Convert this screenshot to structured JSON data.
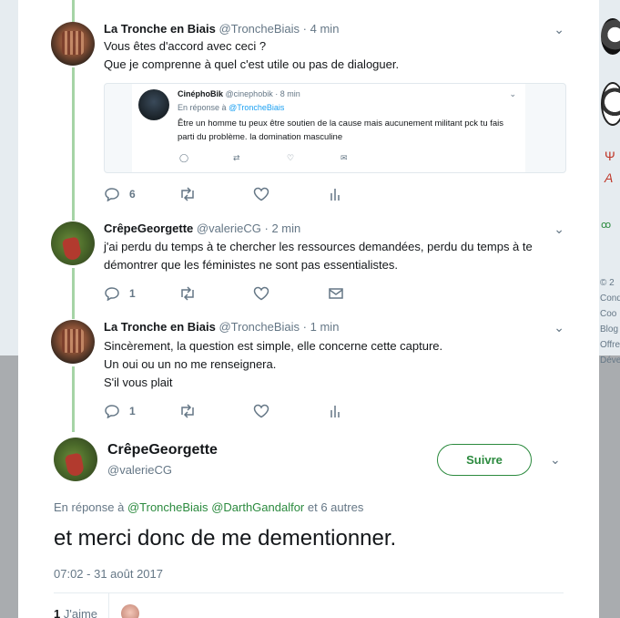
{
  "tweets": [
    {
      "name": "La Tronche en Biais",
      "handle": "@TroncheBiais",
      "dot": "·",
      "time": "4 min",
      "lines": [
        "Vous êtes d'accord avec ceci ?",
        "Que je comprenne à quel c'est utile ou pas de dialoguer."
      ],
      "reply_count": "6",
      "quote": {
        "name": "CinéphoBik",
        "handle": "@cinephobik",
        "dot": "·",
        "time": "8 min",
        "reply_prefix": "En réponse à",
        "reply_link": "@TroncheBiais",
        "text": "Être un homme tu peux être soutien de la cause mais aucunement militant pck tu fais parti du problème. la domination masculine"
      }
    },
    {
      "name": "CrêpeGeorgette",
      "handle": "@valerieCG",
      "dot": "·",
      "time": "2 min",
      "lines": [
        "j'ai perdu du temps à te chercher les ressources demandées, perdu du temps à te",
        "démontrer que les féministes ne sont pas essentialistes."
      ],
      "reply_count": "1"
    },
    {
      "name": "La Tronche en Biais",
      "handle": "@TroncheBiais",
      "dot": "·",
      "time": "1 min",
      "lines": [
        "Sincèrement, la question est simple, elle concerne cette capture.",
        "Un oui ou un no me renseignera.",
        "S'il vous plait"
      ],
      "reply_count": "1"
    }
  ],
  "main_tweet": {
    "name": "CrêpeGeorgette",
    "handle": "@valerieCG",
    "follow_label": "Suivre",
    "reply_prefix": "En réponse à",
    "reply_link1": "@TroncheBiais",
    "reply_link2": "@DarthGandalfor",
    "reply_suffix": "et 6 autres",
    "text": "et merci donc de me dementionner.",
    "timestamp": "07:02 - 31 août 2017",
    "likes_count": "1",
    "likes_label": "J'aime"
  },
  "right_sidebar": {
    "psi": "Ψ",
    "a": "A",
    "footer_lines": [
      "© 2",
      "Cond",
      "Coo",
      "Blog",
      "Offre",
      "Déve"
    ]
  },
  "colors": {
    "brand_green": "#2b8a3e",
    "thread_line": "#a6d4a6",
    "text_primary": "#14171a",
    "text_secondary": "#657786",
    "link_blue": "#1da1f2"
  }
}
